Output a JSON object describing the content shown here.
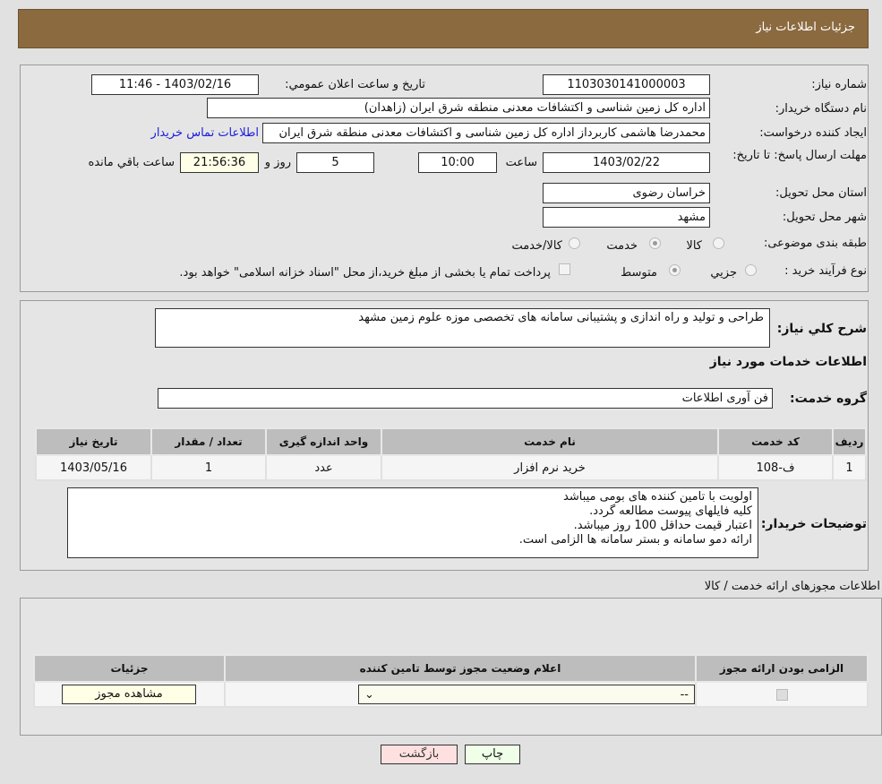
{
  "header": {
    "title": "جزئیات اطلاعات نیاز"
  },
  "form": {
    "need_number_label": "شماره نیاز:",
    "need_number": "1103030141000003",
    "announce_label": "تاريخ و ساعت اعلان عمومي:",
    "announce_value": "1403/02/16 - 11:46",
    "buyer_org_label": "نام دستگاه خریدار:",
    "buyer_org": "اداره کل زمین شناسی و اکتشافات معدنی منطقه شرق ایران (زاهدان)",
    "creator_label": "ایجاد کننده درخواست:",
    "creator": "محمدرضا هاشمی کاربرداز اداره کل زمین شناسی و اکتشافات معدنی منطقه شرق ایران",
    "contact_link": "اطلاعات تماس خریدار",
    "deadline_label": "مهلت ارسال پاسخ: تا تاریخ:",
    "deadline_date": "1403/02/22",
    "time_label": "ساعت",
    "deadline_time": "10:00",
    "days": "5",
    "days_label": "روز و",
    "remaining": "21:56:36",
    "remaining_label": "ساعت باقي مانده",
    "province_label": "استان محل تحویل:",
    "province": "خراسان رضوی",
    "city_label": "شهر محل تحویل:",
    "city": "مشهد",
    "category_label": "طبقه بندی موضوعی:",
    "category_options": [
      "کالا",
      "خدمت",
      "کالا/خدمت"
    ],
    "category_selected": "خدمت",
    "process_label": "نوع فرآیند خرید :",
    "process_options": [
      "جزيي",
      "متوسط"
    ],
    "process_selected": "متوسط",
    "payment_note": "پرداخت تمام یا بخشی از مبلغ خرید،از محل \"اسناد خزانه اسلامی\" خواهد بود."
  },
  "details": {
    "summary_label": "شرح كلي نياز:",
    "summary": "طراحی و تولید و راه اندازی و پشتیبانی سامانه های تخصصی موزه علوم زمین مشهد",
    "services_title": "اطلاعات خدمات مورد نیاز",
    "group_label": "گروه خدمت:",
    "group": "فن آوری اطلاعات",
    "table": {
      "headers": [
        "ردیف",
        "کد خدمت",
        "نام خدمت",
        "واحد اندازه گیری",
        "تعداد / مقدار",
        "تاریخ نیاز"
      ],
      "rows": [
        [
          "1",
          "ف-108",
          "خرید نرم افزار",
          "عدد",
          "1",
          "1403/05/16"
        ]
      ]
    },
    "notes_label": "توضیحات خریدار:",
    "notes": [
      "اولویت با تامین کننده های بومی میباشد",
      "کلیه فایلهای پیوست مطالعه گردد.",
      "اعتبار قیمت حداقل 100 روز میباشد.",
      "ارائه دمو سامانه و بستر سامانه ها الزامی است."
    ]
  },
  "permits": {
    "title": "اطلاعات مجوزهای ارائه خدمت / کالا",
    "headers": [
      "الزامی بودن ارائه مجوز",
      "اعلام وضعیت مجوز توسط تامین کننده",
      "جزئیات"
    ],
    "select_value": "--",
    "view_button": "مشاهده مجوز",
    "required_checked": true
  },
  "buttons": {
    "back": "بازگشت",
    "print": "چاپ"
  },
  "colors": {
    "header": "#8c6a3f",
    "link": "#1a1ae0",
    "back_button": "#ffe0e0",
    "print_button": "#efffe8"
  }
}
